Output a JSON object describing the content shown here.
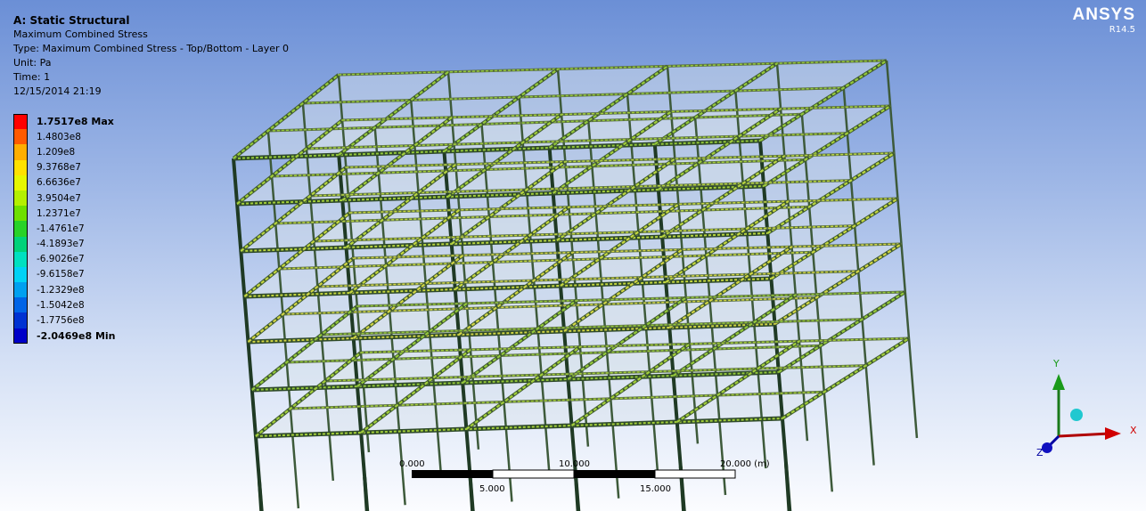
{
  "header": {
    "title": "A: Static Structural",
    "result": "Maximum Combined Stress",
    "type": "Type: Maximum Combined Stress - Top/Bottom - Layer 0",
    "unit": "Unit: Pa",
    "time": "Time: 1",
    "date": "12/15/2014 21:19"
  },
  "logo": {
    "brand": "ANSYS",
    "version": "R14.5"
  },
  "legend": [
    {
      "label": "1.7517e8 Max",
      "color": "#ff0000",
      "bold": true
    },
    {
      "label": "1.4803e8",
      "color": "#ff5a00"
    },
    {
      "label": "1.209e8",
      "color": "#ffae00"
    },
    {
      "label": "9.3768e7",
      "color": "#ffe100"
    },
    {
      "label": "6.6636e7",
      "color": "#e6f700"
    },
    {
      "label": "3.9504e7",
      "color": "#b4f000"
    },
    {
      "label": "1.2371e7",
      "color": "#6ee000"
    },
    {
      "label": "-1.4761e7",
      "color": "#28d228"
    },
    {
      "label": "-4.1893e7",
      "color": "#00d27a"
    },
    {
      "label": "-6.9026e7",
      "color": "#00e0c0"
    },
    {
      "label": "-9.6158e7",
      "color": "#00d2f5"
    },
    {
      "label": "-1.2329e8",
      "color": "#00a0f0"
    },
    {
      "label": "-1.5042e8",
      "color": "#0064e6"
    },
    {
      "label": "-1.7756e8",
      "color": "#0032d2"
    },
    {
      "label": "-2.0469e8 Min",
      "color": "#0000c8",
      "bold": true
    }
  ],
  "scale": {
    "top_labels": [
      "0.000",
      "10.000",
      "20.000 (m)"
    ],
    "bottom_labels": [
      "5.000",
      "15.000"
    ]
  },
  "triad": {
    "x": "X",
    "y": "Y",
    "z": "Z"
  }
}
